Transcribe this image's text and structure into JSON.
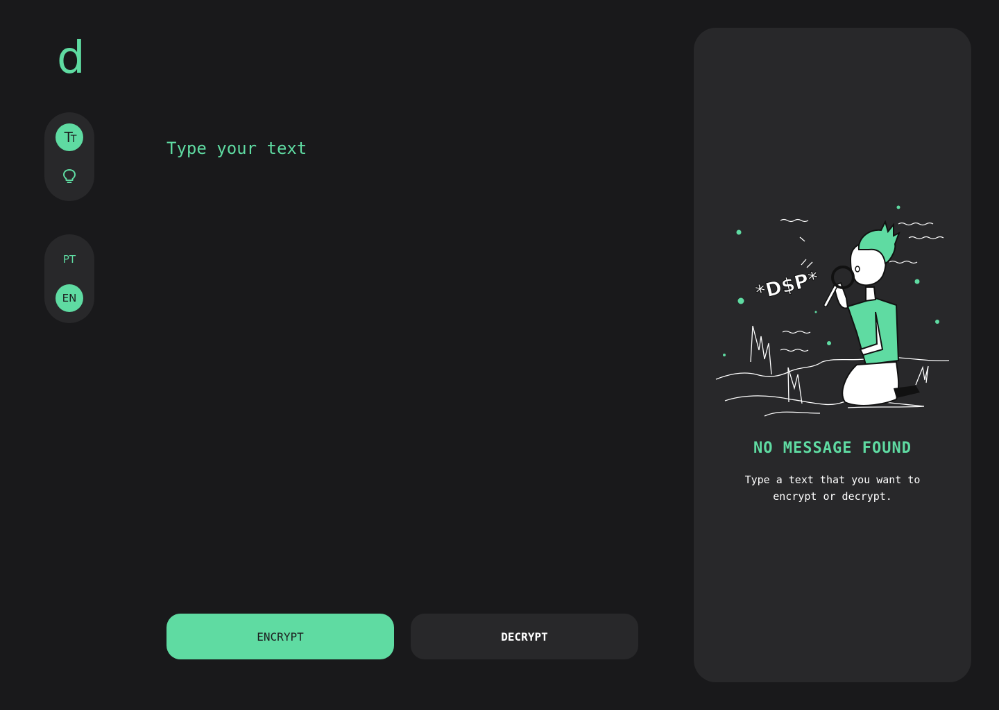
{
  "brand": {
    "logo": "d"
  },
  "sidebar": {
    "mode_switch": [
      {
        "icon": "text-size-icon",
        "active": true
      },
      {
        "icon": "lightbulb-icon",
        "active": false
      }
    ],
    "language_switch": [
      {
        "label": "PT",
        "active": false
      },
      {
        "label": "EN",
        "active": true
      }
    ]
  },
  "editor": {
    "placeholder": "Type your text",
    "value": ""
  },
  "actions": {
    "encrypt_label": "ENCRYPT",
    "decrypt_label": "DECRYPT"
  },
  "result_panel": {
    "illustration_text": "*D$P*",
    "title": "NO MESSAGE FOUND",
    "description": "Type a text that you want to encrypt or decrypt."
  },
  "colors": {
    "accent": "#5fdba2",
    "background": "#19191b",
    "surface": "#28282a"
  }
}
